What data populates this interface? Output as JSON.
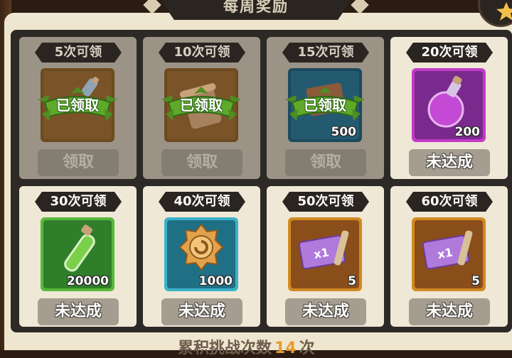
{
  "header": {
    "title": "每周奖励"
  },
  "rewards": [
    {
      "label": "5次可领",
      "stamp": "已领取",
      "action": "领取",
      "item_icon": "potion-scroll-icon",
      "qty": ""
    },
    {
      "label": "10次可领",
      "stamp": "已领取",
      "action": "领取",
      "item_icon": "scroll-icon",
      "qty": ""
    },
    {
      "label": "15次可领",
      "stamp": "已领取",
      "action": "领取",
      "item_icon": "card-pack-icon",
      "qty": "500"
    },
    {
      "label": "20次可领",
      "action": "未达成",
      "item_icon": "purple-potion-icon",
      "qty": "200"
    },
    {
      "label": "30次可领",
      "action": "未达成",
      "item_icon": "green-vial-icon",
      "qty": "20000"
    },
    {
      "label": "40次可领",
      "action": "未达成",
      "item_icon": "gold-coin-icon",
      "qty": "1000"
    },
    {
      "label": "50次可领",
      "action": "未达成",
      "item_icon": "x1-ticket-icon",
      "qty": "5"
    },
    {
      "label": "60次可领",
      "action": "未达成",
      "item_icon": "x1-ticket-icon",
      "qty": "5"
    }
  ],
  "footer": {
    "text_prefix": "累积挑战次数",
    "count": "14",
    "text_suffix": "次"
  },
  "colors": {
    "panel": "#2d2926",
    "card_claimed": "#9b9386",
    "card_pending": "#efe8d6",
    "accent_gold": "#e89a2c",
    "stamp_green": "#5fa92b"
  }
}
